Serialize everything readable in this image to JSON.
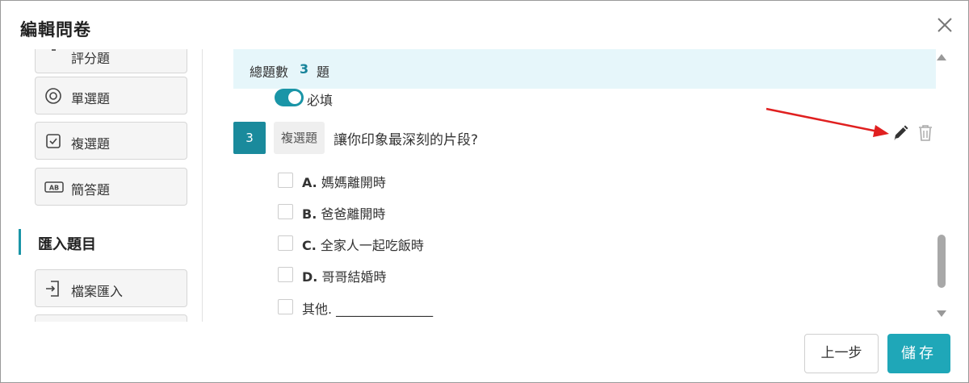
{
  "dialog": {
    "title": "編輯問卷"
  },
  "sidebar": {
    "partial_item": "評分題",
    "items": [
      {
        "label": "單選題",
        "icon": "radio-icon"
      },
      {
        "label": "複選題",
        "icon": "checkbox-icon"
      },
      {
        "label": "簡答題",
        "icon": "text-ab-icon"
      }
    ],
    "import_section": {
      "title": "匯入題目",
      "items": [
        {
          "label": "檔案匯入",
          "icon": "file-import-icon"
        }
      ]
    }
  },
  "summary": {
    "prefix": "總題數",
    "count": "3",
    "suffix": "題"
  },
  "question": {
    "required_label": "必填",
    "required": true,
    "number": "3",
    "type": "複選題",
    "text": "讓你印象最深刻的片段?",
    "options": [
      {
        "letter": "A.",
        "text": "媽媽離開時"
      },
      {
        "letter": "B.",
        "text": "爸爸離開時"
      },
      {
        "letter": "C.",
        "text": "全家人一起吃飯時"
      },
      {
        "letter": "D.",
        "text": "哥哥結婚時"
      },
      {
        "letter": "",
        "text": "其他. _______________"
      }
    ]
  },
  "footer": {
    "prev_label": "上一步",
    "save_label": "儲存"
  },
  "colors": {
    "accent": "#1a95a7",
    "save": "#1fa7b8",
    "summary_bg": "#e6f6fa",
    "arrow": "#e02020"
  }
}
